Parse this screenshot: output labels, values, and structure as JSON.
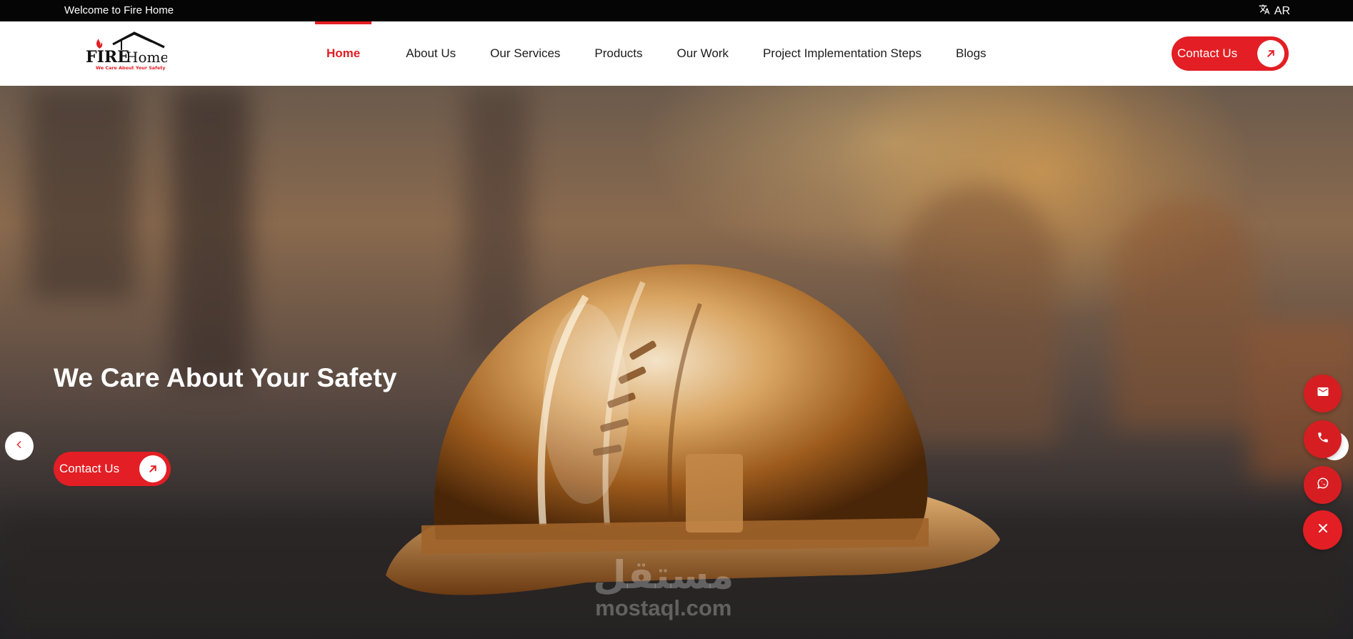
{
  "topbar": {
    "welcome": "Welcome to Fire Home",
    "language": "AR",
    "language_icon": "translate-icon"
  },
  "logo": {
    "text_fire": "FIRE",
    "text_home": "Home",
    "tagline": "We Care About Your Safety"
  },
  "nav": {
    "items": [
      {
        "label": "Home",
        "active": true
      },
      {
        "label": "About Us"
      },
      {
        "label": "Our Services"
      },
      {
        "label": "Products"
      },
      {
        "label": "Our Work"
      },
      {
        "label": "Project Implementation Steps"
      },
      {
        "label": "Blogs"
      }
    ]
  },
  "header_cta": {
    "label": "Contact Us",
    "icon": "arrow-up-right-icon"
  },
  "hero": {
    "title": "We Care About Your Safety",
    "cta_label": "Contact Us",
    "cta_icon": "arrow-up-right-icon"
  },
  "slider": {
    "prev_icon": "chevron-left-icon",
    "next_icon": "chevron-right-icon"
  },
  "floating_actions": {
    "items": [
      "mail-icon",
      "phone-icon",
      "whatsapp-icon"
    ],
    "toggle_icon": "close-icon"
  },
  "watermark": {
    "arabic": "مستقل",
    "latin": "mostaql.com"
  },
  "colors": {
    "accent": "#e31e24",
    "topbar": "#050505",
    "text": "#1c1c1c"
  }
}
